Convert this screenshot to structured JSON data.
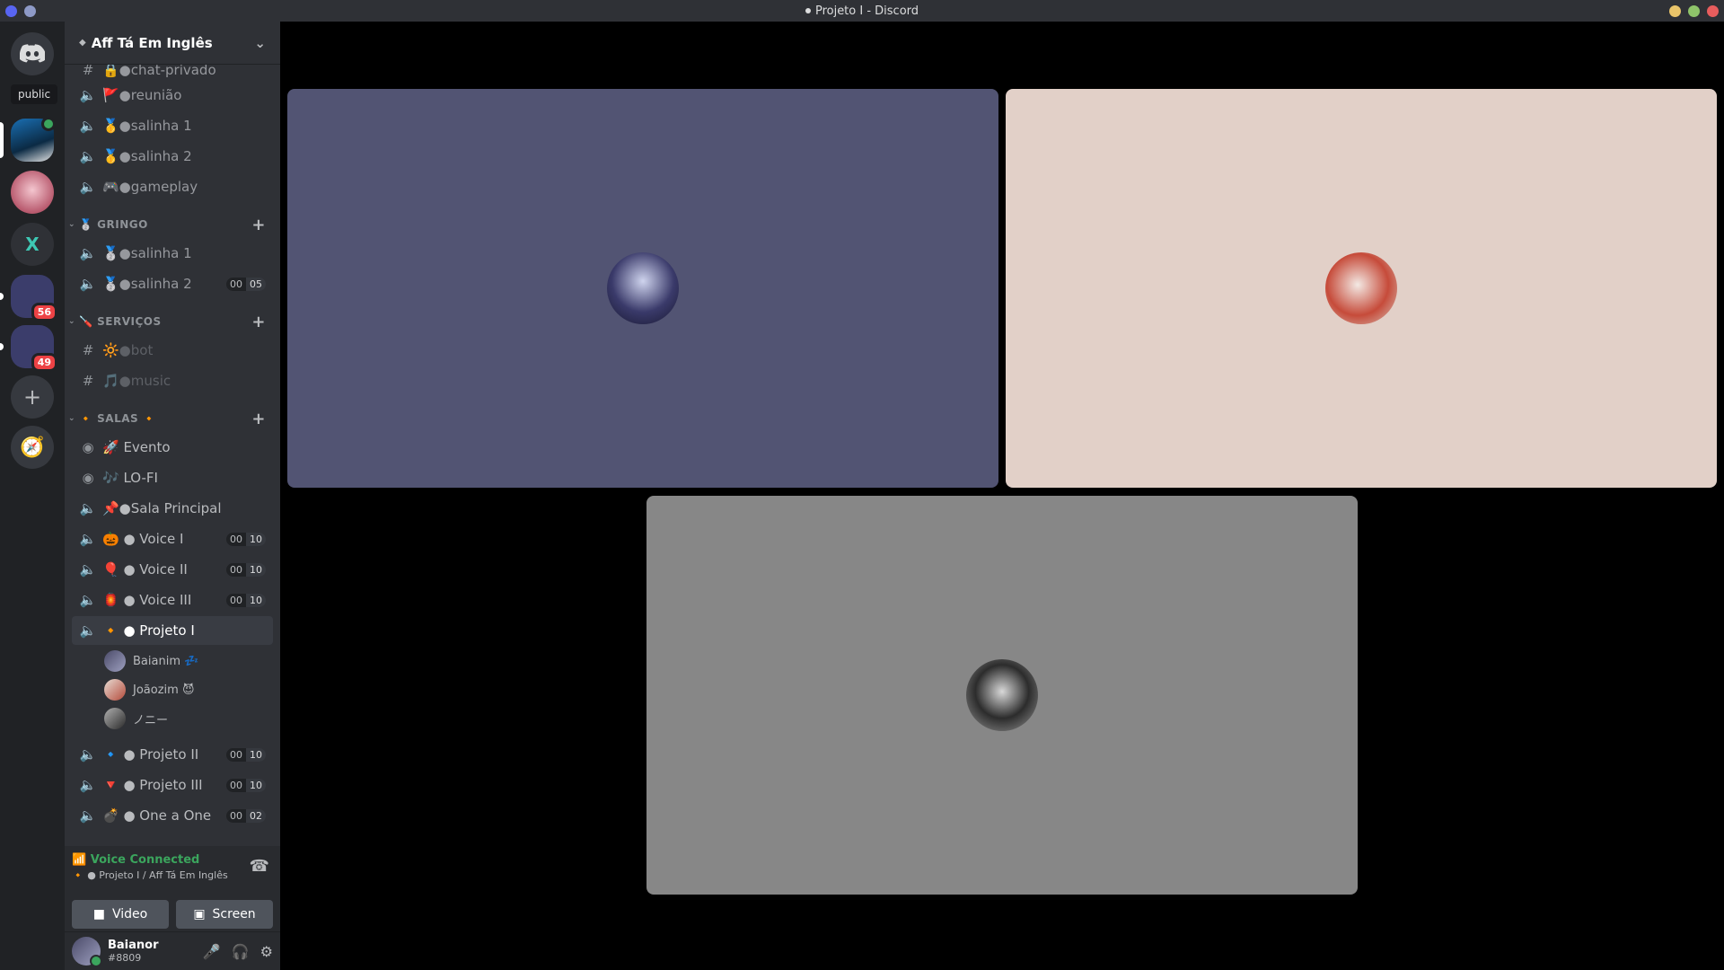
{
  "window": {
    "title": "Projeto I - Discord"
  },
  "rail": {
    "tooltip": "public",
    "badges": [
      "56",
      "49"
    ]
  },
  "guild": {
    "name": "Aff Tá Em Inglês"
  },
  "channels": {
    "top": [
      {
        "icon": "text-channel-icon",
        "name": "🔒●chat-privado"
      },
      {
        "icon": "voice-muted-icon",
        "name": "🚩●reunião"
      },
      {
        "icon": "voice-muted-icon",
        "name": "🥇●salinha 1"
      },
      {
        "icon": "voice-muted-icon",
        "name": "🥇●salinha 2"
      },
      {
        "icon": "voice-muted-icon",
        "name": "🎮●gameplay"
      }
    ],
    "gringo": {
      "title": "🥈 GRINGO",
      "items": [
        {
          "name": "🥈●salinha 1"
        },
        {
          "name": "🥈●salinha 2",
          "count_a": "00",
          "count_b": "05"
        }
      ]
    },
    "servicos": {
      "title": "🪛 SERVIÇOS",
      "items": [
        {
          "name": "🔆●bot"
        },
        {
          "name": "🎵●music"
        }
      ]
    },
    "salas": {
      "title": "🔸 SALAS 🔸",
      "items": [
        {
          "name": "🚀 Evento"
        },
        {
          "name": "🎶 LO-FI"
        },
        {
          "name": "📌●Sala Principal"
        },
        {
          "name": "🎃 ● Voice I",
          "count_a": "00",
          "count_b": "10"
        },
        {
          "name": "🎈 ● Voice II",
          "count_a": "00",
          "count_b": "10"
        },
        {
          "name": "🏮 ● Voice III",
          "count_a": "00",
          "count_b": "10"
        },
        {
          "name": "🔸 ● Projeto I"
        },
        {
          "name": "🔹 ● Projeto II",
          "count_a": "00",
          "count_b": "10"
        },
        {
          "name": "🔻 ● Projeto III",
          "count_a": "00",
          "count_b": "10"
        },
        {
          "name": "💣 ● One a One",
          "count_a": "00",
          "count_b": "02"
        }
      ],
      "voice_users": [
        {
          "name": "Baianim 💤"
        },
        {
          "name": "Joãozim 😈"
        },
        {
          "name": "ノニー"
        }
      ]
    }
  },
  "voice_panel": {
    "status": "Voice Connected",
    "sub": "🔸 ● Projeto I / Aff Tá Em Inglês",
    "video_label": "Video",
    "screen_label": "Screen"
  },
  "user": {
    "name": "Baianor",
    "tag": "#8809"
  },
  "colors": {
    "tile1": "#525473",
    "tile2": "#e2d0c8",
    "tile3": "#878787",
    "accent_green": "#3ba55d"
  }
}
